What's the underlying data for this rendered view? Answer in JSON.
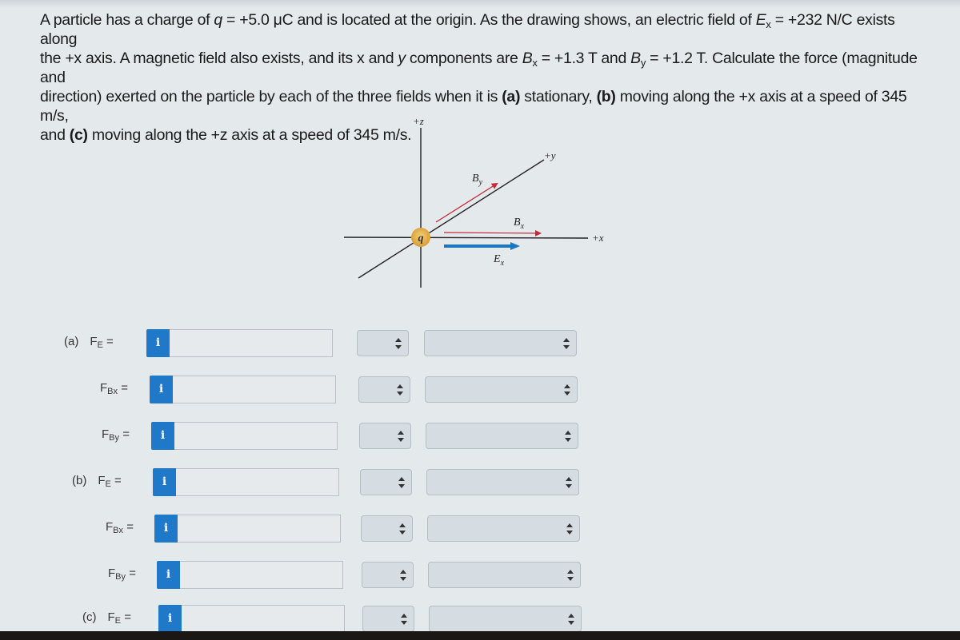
{
  "question": {
    "line1_a": "A particle has a charge of ",
    "q_symbol": "q",
    "line1_b": " = +5.0 μC and is located at the origin. As the drawing shows, an electric field of ",
    "Ex_symbol": "E",
    "Ex_sub": "x",
    "line1_c": " = +232 N/C exists along",
    "line2_a": "the +x axis. A magnetic field also exists, and its x and ",
    "y_symbol": "y",
    "line2_b": " components are ",
    "Bx_symbol": "B",
    "Bx_sub": "x",
    "line2_c": " = +1.3 T and ",
    "By_symbol": "B",
    "By_sub": "y",
    "line2_d": " = +1.2 T. Calculate the force (magnitude and",
    "line3_a": "direction) exerted on the particle by each of the three fields when it is ",
    "part_a": "(a)",
    "line3_b": " stationary, ",
    "part_b": "(b)",
    "line3_c": " moving along the +x axis at a speed of 345 m/s,",
    "line4_a": "and ",
    "part_c": "(c)",
    "line4_b": " moving along the +z axis at a speed of 345 m/s."
  },
  "diagram": {
    "axis_z": "+z",
    "axis_y": "+y",
    "axis_x": "+x",
    "charge": "q",
    "vec_By": "B",
    "vec_By_sub": "y",
    "vec_Bx": "B",
    "vec_Bx_sub": "x",
    "vec_Ex": "E",
    "vec_Ex_sub": "x",
    "colors": {
      "B_arrow": "#c8283a",
      "E_arrow": "#1b77c0",
      "charge": "#e6b24a"
    }
  },
  "answers": [
    {
      "part": "(a)",
      "force": "F",
      "sub": "E",
      "eq": "=",
      "info": "i",
      "value": "",
      "unit": "",
      "direction": ""
    },
    {
      "part": "",
      "force": "F",
      "sub": "Bx",
      "eq": "=",
      "info": "i",
      "value": "",
      "unit": "",
      "direction": ""
    },
    {
      "part": "",
      "force": "F",
      "sub": "By",
      "eq": "=",
      "info": "i",
      "value": "",
      "unit": "",
      "direction": ""
    },
    {
      "part": "(b)",
      "force": "F",
      "sub": "E",
      "eq": "=",
      "info": "i",
      "value": "",
      "unit": "",
      "direction": ""
    },
    {
      "part": "",
      "force": "F",
      "sub": "Bx",
      "eq": "=",
      "info": "i",
      "value": "",
      "unit": "",
      "direction": ""
    },
    {
      "part": "",
      "force": "F",
      "sub": "By",
      "eq": "=",
      "info": "i",
      "value": "",
      "unit": "",
      "direction": ""
    },
    {
      "part": "(c)",
      "force": "F",
      "sub": "E",
      "eq": "=",
      "info": "i",
      "value": "",
      "unit": "",
      "direction": ""
    }
  ]
}
